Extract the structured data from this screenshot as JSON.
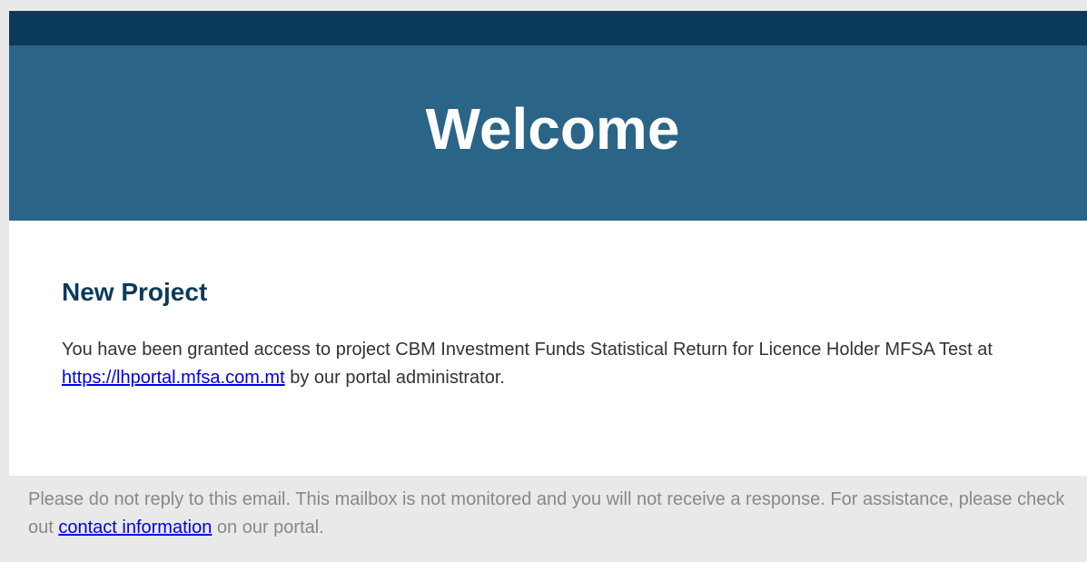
{
  "header": {
    "title": "Welcome"
  },
  "content": {
    "heading": "New Project",
    "paragraph_before": "You have been granted access to project CBM Investment Funds Statistical Return for Licence Holder MFSA Test at ",
    "portal_link": "https://lhportal.mfsa.com.mt",
    "paragraph_after": " by our portal administrator."
  },
  "footer": {
    "text_before": "Please do not reply to this email. This mailbox is not monitored and you will not receive a response. For assistance, please check out ",
    "contact_link": "contact information",
    "text_after": " on our portal."
  },
  "colors": {
    "top_stripe": "#0c3a5b",
    "hero_background": "#2a6487",
    "heading": "#0c3a5b",
    "link": "#0000ee",
    "footer_background": "#e9e9e9"
  }
}
